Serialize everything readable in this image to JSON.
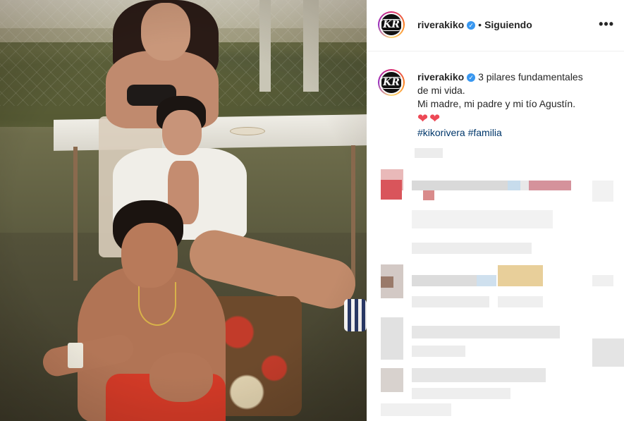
{
  "post": {
    "account": {
      "username": "riverakiko",
      "verified_icon": "verified-badge-icon",
      "avatar_text": "KR"
    },
    "header": {
      "separator": "•",
      "follow_status": "Siguiendo",
      "more_label": "•••"
    },
    "caption": {
      "text_line1": "3 pilares fundamentales",
      "text_line2": "de mi vida.",
      "text_line3": "Mi madre, mi padre y mi tío Agustín.",
      "hearts": "❤❤",
      "hashtags": "#kikorivera #familia"
    },
    "colors": {
      "verified": "#3897f0",
      "hashtag": "#00376b",
      "heart": "#ed4956"
    }
  }
}
